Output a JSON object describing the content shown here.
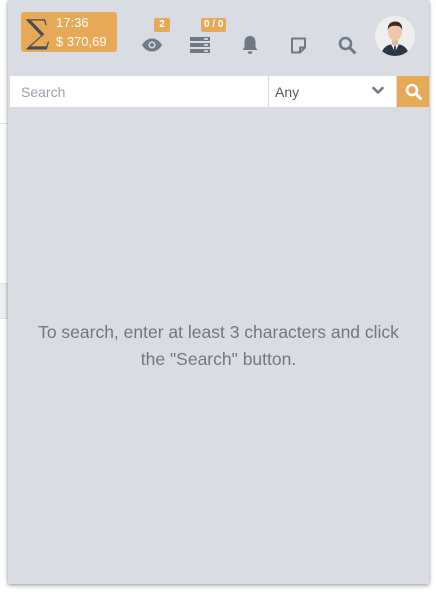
{
  "balance": {
    "symbol": "∑",
    "time": "17:36",
    "amount": "$ 370,69"
  },
  "header_icons": {
    "watch": {
      "icon": "eye-icon",
      "badge": "2"
    },
    "list": {
      "icon": "list-icon",
      "badge": "0 / 0"
    },
    "notifications": {
      "icon": "bell-icon"
    },
    "notes": {
      "icon": "note-icon"
    },
    "search": {
      "icon": "search-icon"
    },
    "profile": {
      "icon": "avatar"
    }
  },
  "search": {
    "placeholder": "Search",
    "value": "",
    "scope_selected": "Any"
  },
  "results": {
    "empty_message": "To search, enter at least 3 characters and click the \"Search\" button."
  },
  "colors": {
    "accent": "#e6a955",
    "panel_bg": "#d9dde3",
    "icon": "#6f7885",
    "message_text": "#6f7783"
  }
}
